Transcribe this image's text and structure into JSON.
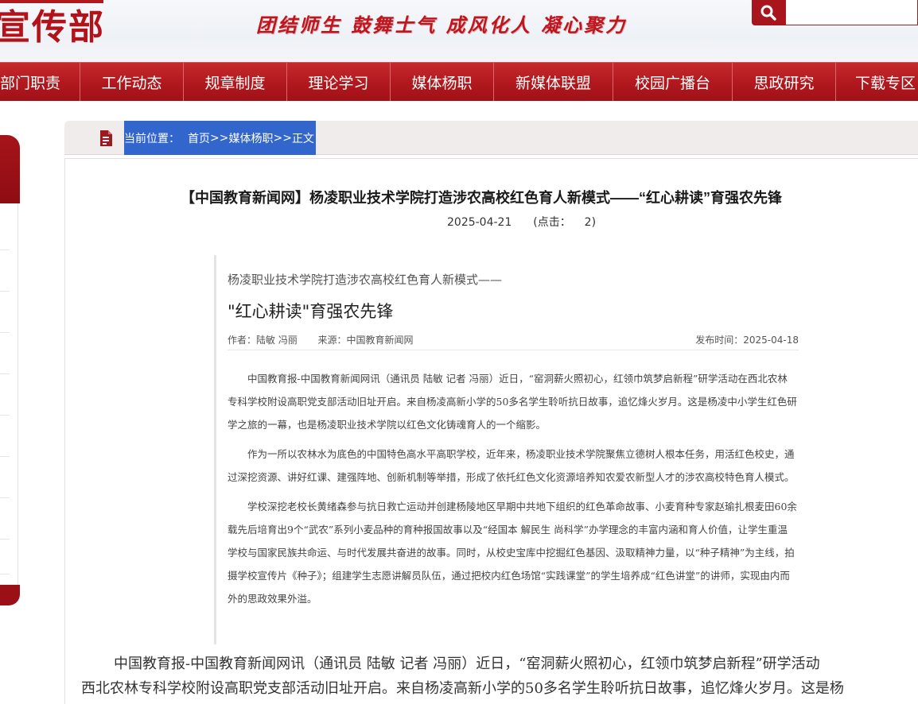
{
  "header": {
    "logo_text": "宣传部",
    "slogan": "团结师生  鼓舞士气  成风化人  凝心聚力",
    "search_placeholder": ""
  },
  "nav": {
    "items": [
      "部门职责",
      "工作动态",
      "规章制度",
      "理论学习",
      "媒体杨职",
      "新媒体联盟",
      "校园广播台",
      "思政研究",
      "下载专区"
    ]
  },
  "breadcrumb": {
    "prefix": "当前位置：",
    "home": "首页",
    "sep1": ">>",
    "section": "媒体杨职",
    "sep2": ">>",
    "current": "正文"
  },
  "article": {
    "title": "【中国教育新闻网】杨凌职业技术学院打造涉农高校红色育人新模式——“红心耕读”育强农先锋",
    "date": "2025-04-21",
    "clicks_label": "(点击：",
    "clicks_value": "2)"
  },
  "clipping": {
    "subtitle": "杨凌职业技术学院打造涉农高校红色育人新模式——",
    "headline": "\"红心耕读\"育强农先锋",
    "author": "作者：陆敏 冯丽",
    "source": "来源：中国教育新闻网",
    "published": "发布时间：2025-04-18",
    "paragraphs": [
      "中国教育报-中国教育新闻网讯（通讯员 陆敏 记者 冯丽）近日，“窑洞薪火照初心，红领巾筑梦启新程”研学活动在西北农林专科学校附设高职党支部活动旧址开启。来自杨凌高新小学的50多名学生聆听抗日故事，追忆烽火岁月。这是杨凌中小学生红色研学之旅的一幕，也是杨凌职业技术学院以红色文化铸魂育人的一个缩影。",
      "作为一所以农林水为底色的中国特色高水平高职学校，近年来，杨凌职业技术学院聚焦立德树人根本任务，用活红色校史，通过深挖资源、讲好红课、建强阵地、创新机制等举措，形成了依托红色文化资源培养知农爱农新型人才的涉农高校特色育人模式。",
      "学校深挖老校长黄绪森参与抗日救亡运动并创建杨陵地区早期中共地下组织的红色革命故事、小麦育种专家赵瑜扎根麦田60余载先后培育出9个“武农”系列小麦品种的育种报国故事以及“经国本 解民生 尚科学”办学理念的丰富内涵和育人价值，让学生重温学校与国家民族共命运、与时代发展共奋进的故事。同时，从校史宝库中挖掘红色基因、汲取精神力量，以“种子精神”为主线，拍摄学校宣传片《种子》；组建学生志愿讲解员队伍，通过把校内红色场馆“实践课堂”的学生培养成“红色讲堂”的讲师，实现由内而外的思政效果外溢。"
    ]
  },
  "body": {
    "lines": [
      "中国教育报-中国教育新闻网讯（通讯员 陆敏 记者 冯丽）近日，“窑洞薪火照初心，红领巾筑梦启新程”研学活动",
      "西北农林专科学校附设高职党支部活动旧址开启。来自杨凌高新小学的50多名学生聆听抗日故事，追忆烽火岁月。这是杨"
    ]
  },
  "colors": {
    "brand_red": "#b1181d",
    "crumb_blue": "#3366cc"
  },
  "icons": {
    "search": "search-icon",
    "document": "document-icon"
  }
}
